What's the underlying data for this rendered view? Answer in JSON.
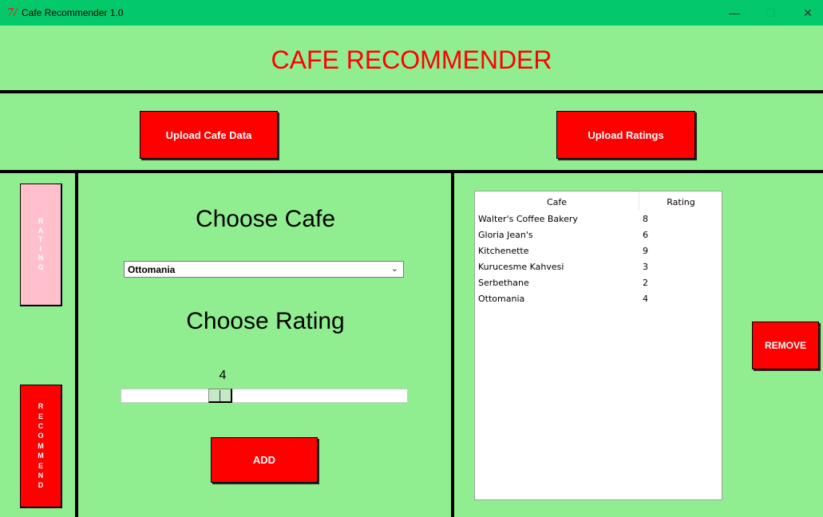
{
  "window": {
    "icon": "tk-feather-icon",
    "icon_text": "7/",
    "title": "Cafe Recommender 1.0",
    "minimize_glyph": "—",
    "maximize_glyph": "☐",
    "close_glyph": "✕"
  },
  "header": {
    "title": "CAFE RECOMMENDER"
  },
  "upload": {
    "cafe_data_label": "Upload Cafe Data",
    "ratings_label": "Upload Ratings"
  },
  "sidebar": {
    "rating_letters": [
      "R",
      "A",
      "T",
      "I",
      "N",
      "G"
    ],
    "recommend_letters": [
      "R",
      "E",
      "C",
      "O",
      "M",
      "M",
      "E",
      "N",
      "D"
    ]
  },
  "form": {
    "choose_cafe_label": "Choose Cafe",
    "selected_cafe": "Ottomania",
    "chevron_glyph": "⌄",
    "choose_rating_label": "Choose Rating",
    "rating_value": "4",
    "add_label": "ADD"
  },
  "ratings_table": {
    "columns": [
      "Cafe",
      "Rating"
    ],
    "rows": [
      [
        "Walter's Coffee Bakery",
        "8"
      ],
      [
        "Gloria Jean's",
        "6"
      ],
      [
        "Kitchenette",
        "9"
      ],
      [
        "Kurucesme Kahvesi",
        "3"
      ],
      [
        "Serbethane",
        "2"
      ],
      [
        "Ottomania",
        "4"
      ]
    ]
  },
  "remove_label": "REMOVE",
  "colors": {
    "background": "#90ee90",
    "titlebar": "#03c96b",
    "button_red": "#ff0000",
    "rating_button_disabled": "#ffc0cb",
    "title_red": "#ff0000"
  }
}
